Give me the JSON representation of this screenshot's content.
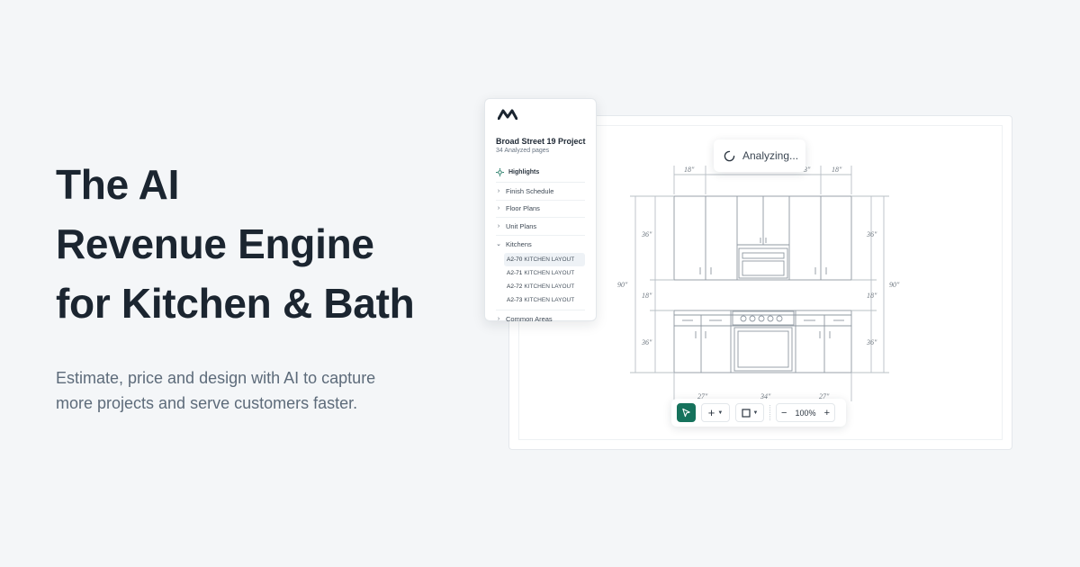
{
  "hero": {
    "title_lines": [
      "The AI",
      "Revenue Engine",
      "for Kitchen & Bath"
    ],
    "subtitle_lines": [
      "Estimate, price and design with AI to capture",
      "more projects and serve customers faster."
    ]
  },
  "status": {
    "analyzing_label": "Analyzing..."
  },
  "panel": {
    "project_title": "Broad Street 19 Project",
    "project_sub": "34 Analyzed pages",
    "highlights_label": "Highlights",
    "nav": [
      {
        "label": "Finish Schedule"
      },
      {
        "label": "Floor Plans"
      },
      {
        "label": "Unit Plans"
      },
      {
        "label": "Kitchens"
      },
      {
        "label": "Common Areas"
      }
    ],
    "kitchen_items": [
      {
        "code": "A2-70",
        "name": "KITCHEN LAYOUT"
      },
      {
        "code": "A2-71",
        "name": "KITCHEN LAYOUT"
      },
      {
        "code": "A2-72",
        "name": "KITCHEN LAYOUT"
      },
      {
        "code": "A2-73",
        "name": "KITCHEN LAYOUT"
      }
    ]
  },
  "drawing": {
    "dims_top": [
      "18\"",
      "3\"",
      "18\""
    ],
    "dims_left": [
      "36\"",
      "18\"",
      "36\""
    ],
    "dims_right": [
      "36\"",
      "18\"",
      "36\""
    ],
    "overall_left": "90\"",
    "overall_right": "90\"",
    "dims_bottom": [
      "27\"",
      "34\"",
      "27\""
    ]
  },
  "toolbar": {
    "zoom_value": "100%"
  },
  "colors": {
    "accent": "#16725c",
    "background": "#f4f6f8",
    "line": "#9aa3ab"
  }
}
